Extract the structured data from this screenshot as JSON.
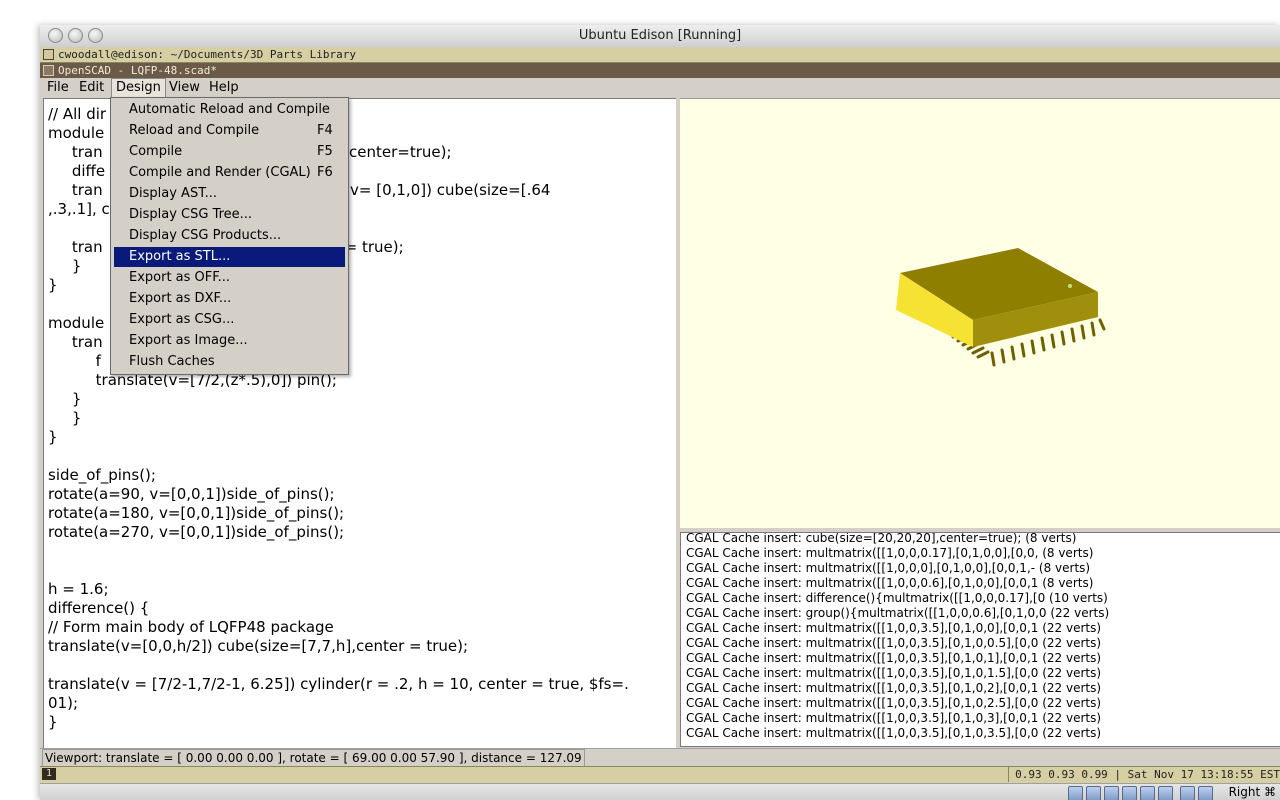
{
  "vbox": {
    "title": "Ubuntu Edison [Running]"
  },
  "terminal_bar": {
    "title": "cwoodall@edison: ~/Documents/3D Parts Library"
  },
  "app_bar": {
    "title": "OpenSCAD - LQFP-48.scad*"
  },
  "menubar": {
    "items": [
      "File",
      "Edit",
      "Design",
      "View",
      "Help"
    ],
    "active": "Design"
  },
  "design_menu": {
    "items": [
      {
        "label": "Automatic Reload and Compile",
        "shortcut": ""
      },
      {
        "label": "Reload and Compile",
        "shortcut": "F4"
      },
      {
        "label": "Compile",
        "shortcut": "F5"
      },
      {
        "label": "Compile and Render (CGAL)",
        "shortcut": "F6"
      },
      {
        "label": "Display AST...",
        "shortcut": ""
      },
      {
        "label": "Display CSG Tree...",
        "shortcut": ""
      },
      {
        "label": "Display CSG Products...",
        "shortcut": ""
      },
      {
        "label": "Export as STL...",
        "shortcut": ""
      },
      {
        "label": "Export as OFF...",
        "shortcut": ""
      },
      {
        "label": "Export as DXF...",
        "shortcut": ""
      },
      {
        "label": "Export as CSG...",
        "shortcut": ""
      },
      {
        "label": "Export as Image...",
        "shortcut": ""
      },
      {
        "label": "Flush Caches",
        "shortcut": ""
      }
    ],
    "selected_index": 7
  },
  "editor": {
    "code": "// All dir\nmodule\n     tran                              ze=[.6,.3,.1], center=true);\n     diffe\n     tran                              ate(a = 51.3, v= [0,1,0]) cube(size=[.64\n,.3,.1], c\n\n     tran                              = 20, center = true);\n     }\n}\n\nmodule\n     tran\n          f\n          translate(v=[7/2,(z*.5),0]) pin();\n     }\n     }\n}\n\nside_of_pins();\nrotate(a=90, v=[0,0,1])side_of_pins();\nrotate(a=180, v=[0,0,1])side_of_pins();\nrotate(a=270, v=[0,0,1])side_of_pins();\n\n\nh = 1.6;\ndifference() {\n// Form main body of LQFP48 package\ntranslate(v=[0,0,h/2]) cube(size=[7,7,h],center = true);\n\ntranslate(v = [7/2-1,7/2-1, 6.25]) cylinder(r = .2, h = 10, center = true, $fs=.\n01);\n}"
  },
  "console": {
    "lines": [
      "CGAL Cache insert: cube(size=[20,20,20],center=true); (8 verts)",
      "CGAL Cache insert: multmatrix([[1,0,0,0.17],[0,1,0,0],[0,0, (8 verts)",
      "CGAL Cache insert: multmatrix([[1,0,0,0],[0,1,0,0],[0,0,1,- (8 verts)",
      "CGAL Cache insert: multmatrix([[1,0,0,0.6],[0,1,0,0],[0,0,1 (8 verts)",
      "CGAL Cache insert: difference(){multmatrix([[1,0,0,0.17],[0 (10 verts)",
      "CGAL Cache insert: group(){multmatrix([[1,0,0,0.6],[0,1,0,0 (22 verts)",
      "CGAL Cache insert: multmatrix([[1,0,0,3.5],[0,1,0,0],[0,0,1 (22 verts)",
      "CGAL Cache insert: multmatrix([[1,0,0,3.5],[0,1,0,0.5],[0,0 (22 verts)",
      "CGAL Cache insert: multmatrix([[1,0,0,3.5],[0,1,0,1],[0,0,1 (22 verts)",
      "CGAL Cache insert: multmatrix([[1,0,0,3.5],[0,1,0,1.5],[0,0 (22 verts)",
      "CGAL Cache insert: multmatrix([[1,0,0,3.5],[0,1,0,2],[0,0,1 (22 verts)",
      "CGAL Cache insert: multmatrix([[1,0,0,3.5],[0,1,0,2.5],[0,0 (22 verts)",
      "CGAL Cache insert: multmatrix([[1,0,0,3.5],[0,1,0,3],[0,0,1 (22 verts)",
      "CGAL Cache insert: multmatrix([[1,0,0,3.5],[0,1,0,3.5],[0,0 (22 verts)"
    ]
  },
  "status": {
    "viewport": "Viewport: translate = [ 0.00 0.00 0.00 ], rotate = [ 69.00 0.00 57.90 ], distance = 127.09"
  },
  "taskbar": {
    "workspace": "1",
    "clock": "0.93 0.93 0.99 | Sat Nov 17 13:18:55 EST"
  },
  "vbox_status": {
    "host_key": "Right ⌘"
  },
  "colors": {
    "viewport_bg": "#ffffe5",
    "model_top": "#8f7f00",
    "model_side": "#f6e233",
    "selection": "#0a1a7a"
  }
}
